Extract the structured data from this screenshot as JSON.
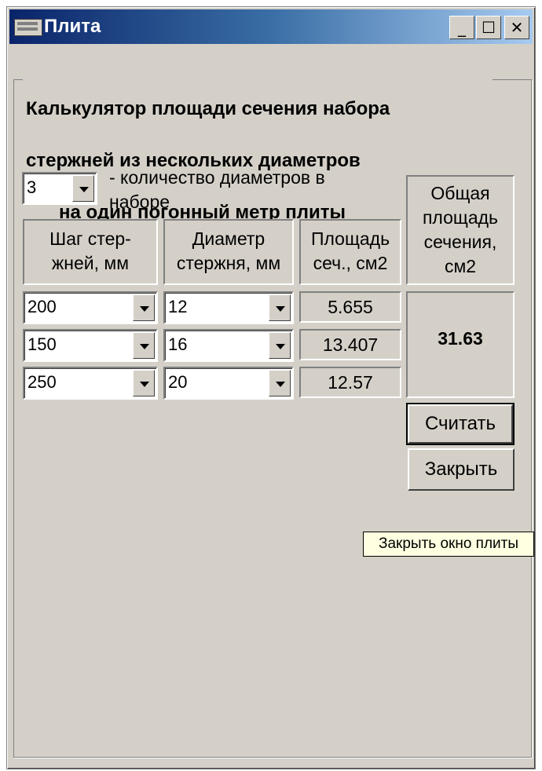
{
  "window": {
    "title": "Плита",
    "controls": {
      "minimize": "_",
      "maximize": "☐",
      "close": "✕"
    }
  },
  "group": {
    "title_lines": [
      "Калькулятор площади сечения набора",
      "стержней из нескольких диаметров",
      "на один погонный метр плиты"
    ]
  },
  "count_combo": {
    "value": "3"
  },
  "count_label": [
    "- количество диаметров в",
    "наборе"
  ],
  "headers": {
    "step": [
      "Шаг стер-",
      "жней, мм"
    ],
    "diameter": [
      "Диаметр",
      "стержня, мм"
    ],
    "area": [
      "Площадь",
      "сеч., см2"
    ],
    "total": [
      "Общая",
      "площадь",
      "сечения,",
      "см2"
    ]
  },
  "rows": [
    {
      "step": "200",
      "diameter": "12",
      "area": "5.655"
    },
    {
      "step": "150",
      "diameter": "16",
      "area": "13.407"
    },
    {
      "step": "250",
      "diameter": "20",
      "area": "12.57"
    }
  ],
  "total_value": "31.63",
  "buttons": {
    "calculate": "Считать",
    "close": "Закрыть"
  },
  "tooltip": "Закрыть окно плиты",
  "icons": {
    "window_icon": "app-window-icon",
    "dropdown": "chevron-down-icon"
  }
}
